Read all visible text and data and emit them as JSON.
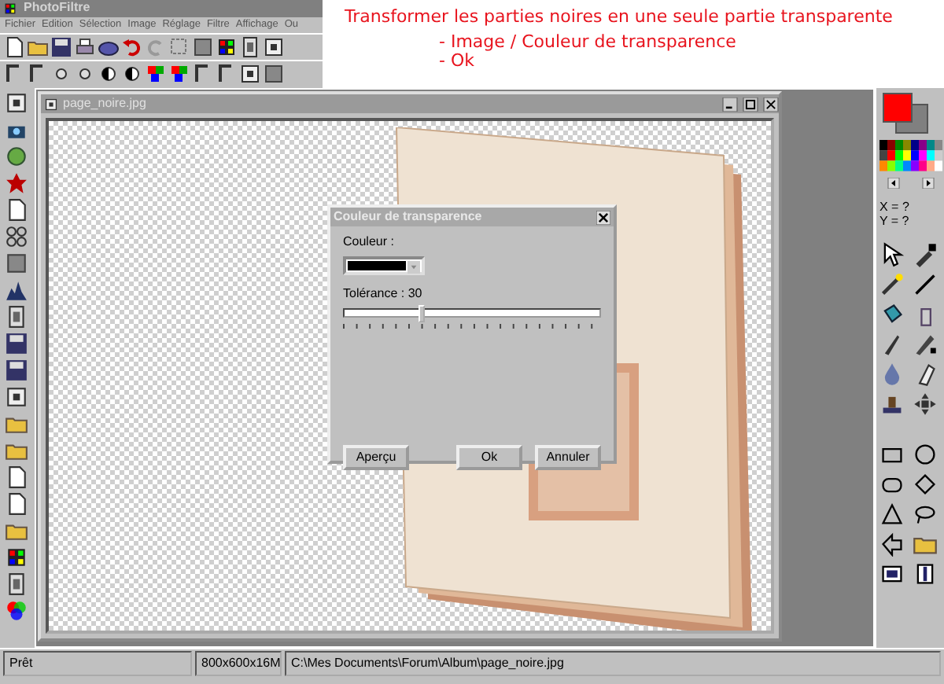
{
  "app_title": "PhotoFiltre",
  "menu": [
    "Fichier",
    "Edition",
    "Sélection",
    "Image",
    "Réglage",
    "Filtre",
    "Affichage",
    "Ou"
  ],
  "annotation": {
    "heading": "Transformer les parties noires en une seule partie transparente",
    "steps": [
      "- Image / Couleur de transparence",
      "- Ok"
    ]
  },
  "document": {
    "title": "page_noire.jpg"
  },
  "dialog": {
    "title": "Couleur de transparence",
    "color_label": "Couleur :",
    "color": "#000000",
    "tolerance_label": "Tolérance : 30",
    "tolerance": {
      "level": 0.3
    },
    "buttons": [
      "Aperçu",
      "Ok",
      "Annuler"
    ]
  },
  "coordinates": [
    "X = ?",
    "Y = ?"
  ],
  "status_bar": [
    "Prêt",
    "800x600x16M",
    "C:\\Mes Documents\\Forum\\Album\\page_noire.jpg"
  ]
}
